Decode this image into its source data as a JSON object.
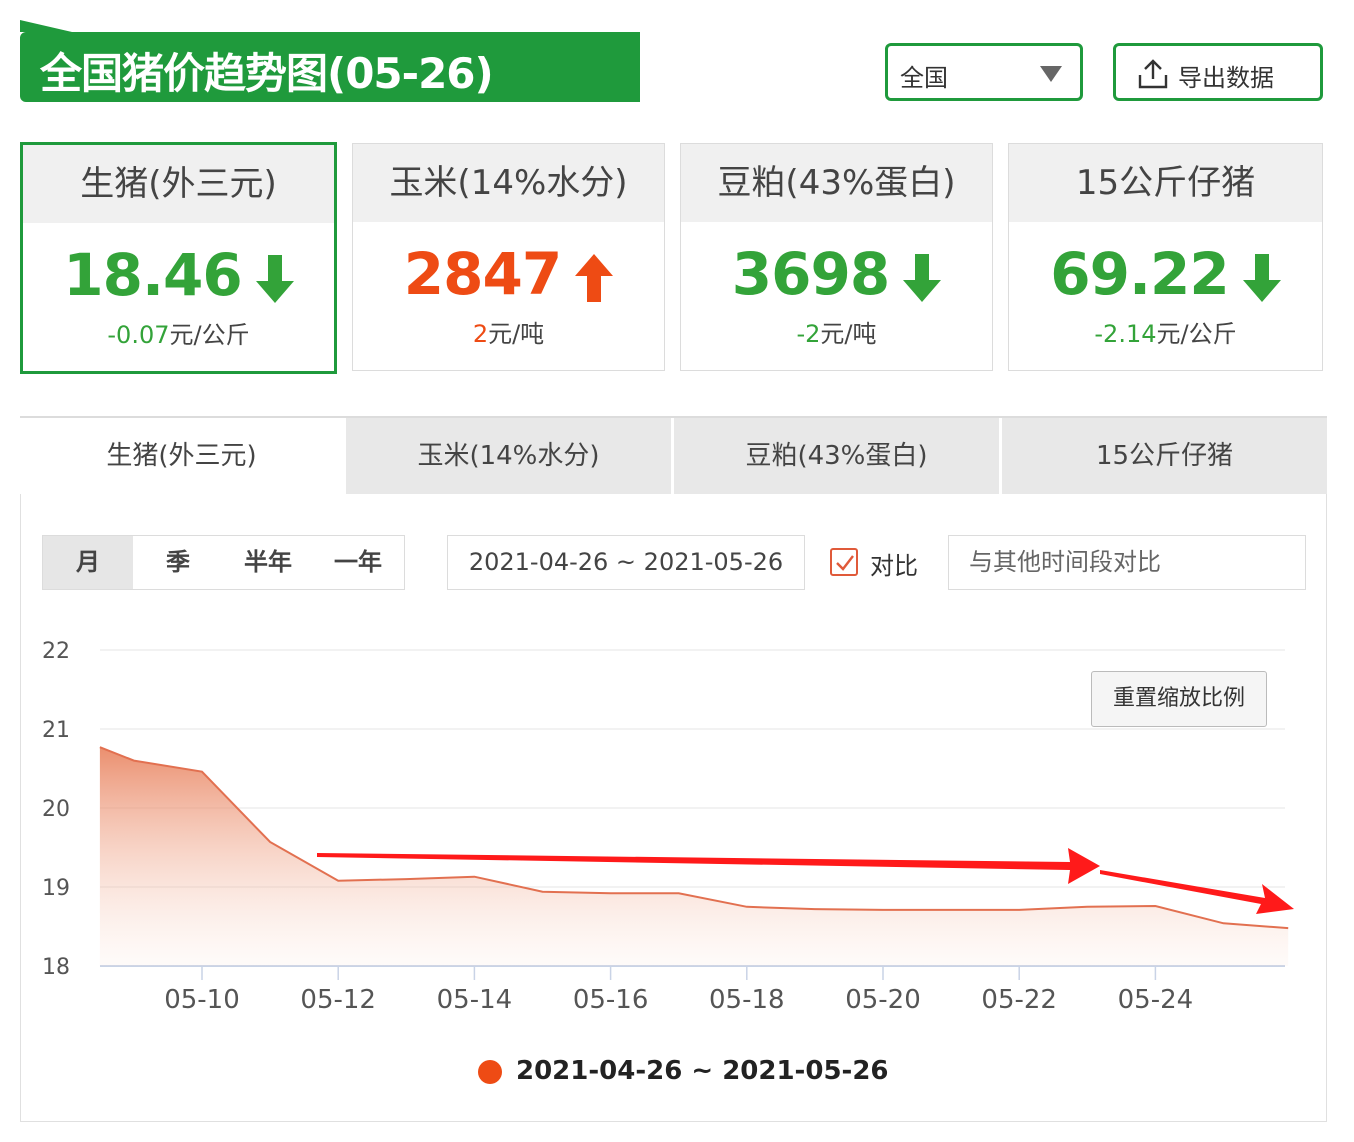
{
  "header": {
    "title": "全国猪价趋势图(05-26)"
  },
  "region_select": {
    "value": "全国"
  },
  "export_button": {
    "label": "导出数据"
  },
  "cards": [
    {
      "name": "生猪(外三元)",
      "price": "18.46",
      "direction": "down",
      "change": "-0.07",
      "unit": "元/公斤",
      "color": "#33a339"
    },
    {
      "name": "玉米(14%水分)",
      "price": "2847",
      "direction": "up",
      "change": "2",
      "unit": "元/吨",
      "color": "#ee4b14"
    },
    {
      "name": "豆粕(43%蛋白)",
      "price": "3698",
      "direction": "down",
      "change": "-2",
      "unit": "元/吨",
      "color": "#33a339"
    },
    {
      "name": "15公斤仔猪",
      "price": "69.22",
      "direction": "down",
      "change": "-2.14",
      "unit": "元/公斤",
      "color": "#33a339"
    }
  ],
  "tabs": [
    "生猪(外三元)",
    "玉米(14%水分)",
    "豆粕(43%蛋白)",
    "15公斤仔猪"
  ],
  "period_options": [
    "月",
    "季",
    "半年",
    "一年"
  ],
  "date_range": "2021-04-26 ~ 2021-05-26",
  "compare": {
    "label": "对比",
    "checked": true,
    "placeholder": "与其他时间段对比"
  },
  "reset_zoom_label": "重置缩放比例",
  "chart_data": {
    "type": "area",
    "series": [
      {
        "name": "2021-04-26 ~ 2021-05-26",
        "color": "#ee4b14",
        "x": [
          "05-08.5",
          "05-09",
          "05-10",
          "05-11",
          "05-12",
          "05-13",
          "05-14",
          "05-15",
          "05-16",
          "05-17",
          "05-18",
          "05-19",
          "05-20",
          "05-21",
          "05-22",
          "05-23",
          "05-24",
          "05-25",
          "05-26"
        ],
        "points": [
          {
            "d": 8.5,
            "v": 20.77
          },
          {
            "d": 9,
            "v": 20.6
          },
          {
            "d": 10,
            "v": 20.46
          },
          {
            "d": 11,
            "v": 19.57
          },
          {
            "d": 12,
            "v": 19.08
          },
          {
            "d": 13,
            "v": 19.1
          },
          {
            "d": 14,
            "v": 19.13
          },
          {
            "d": 15,
            "v": 18.94
          },
          {
            "d": 16,
            "v": 18.92
          },
          {
            "d": 17,
            "v": 18.92
          },
          {
            "d": 18,
            "v": 18.75
          },
          {
            "d": 19,
            "v": 18.72
          },
          {
            "d": 20,
            "v": 18.71
          },
          {
            "d": 21,
            "v": 18.71
          },
          {
            "d": 22,
            "v": 18.71
          },
          {
            "d": 23,
            "v": 18.75
          },
          {
            "d": 24,
            "v": 18.76
          },
          {
            "d": 25,
            "v": 18.54
          },
          {
            "d": 25.95,
            "v": 18.48
          }
        ]
      }
    ],
    "x_tick_labels": [
      "05-10",
      "05-12",
      "05-14",
      "05-16",
      "05-18",
      "05-20",
      "05-22",
      "05-24"
    ],
    "y_tick_labels": [
      "18",
      "19",
      "20",
      "21",
      "22"
    ],
    "ylim": [
      18,
      22
    ],
    "grid": true,
    "legend": "bottom",
    "annotation_arrows_color": "#ff1a1a"
  }
}
